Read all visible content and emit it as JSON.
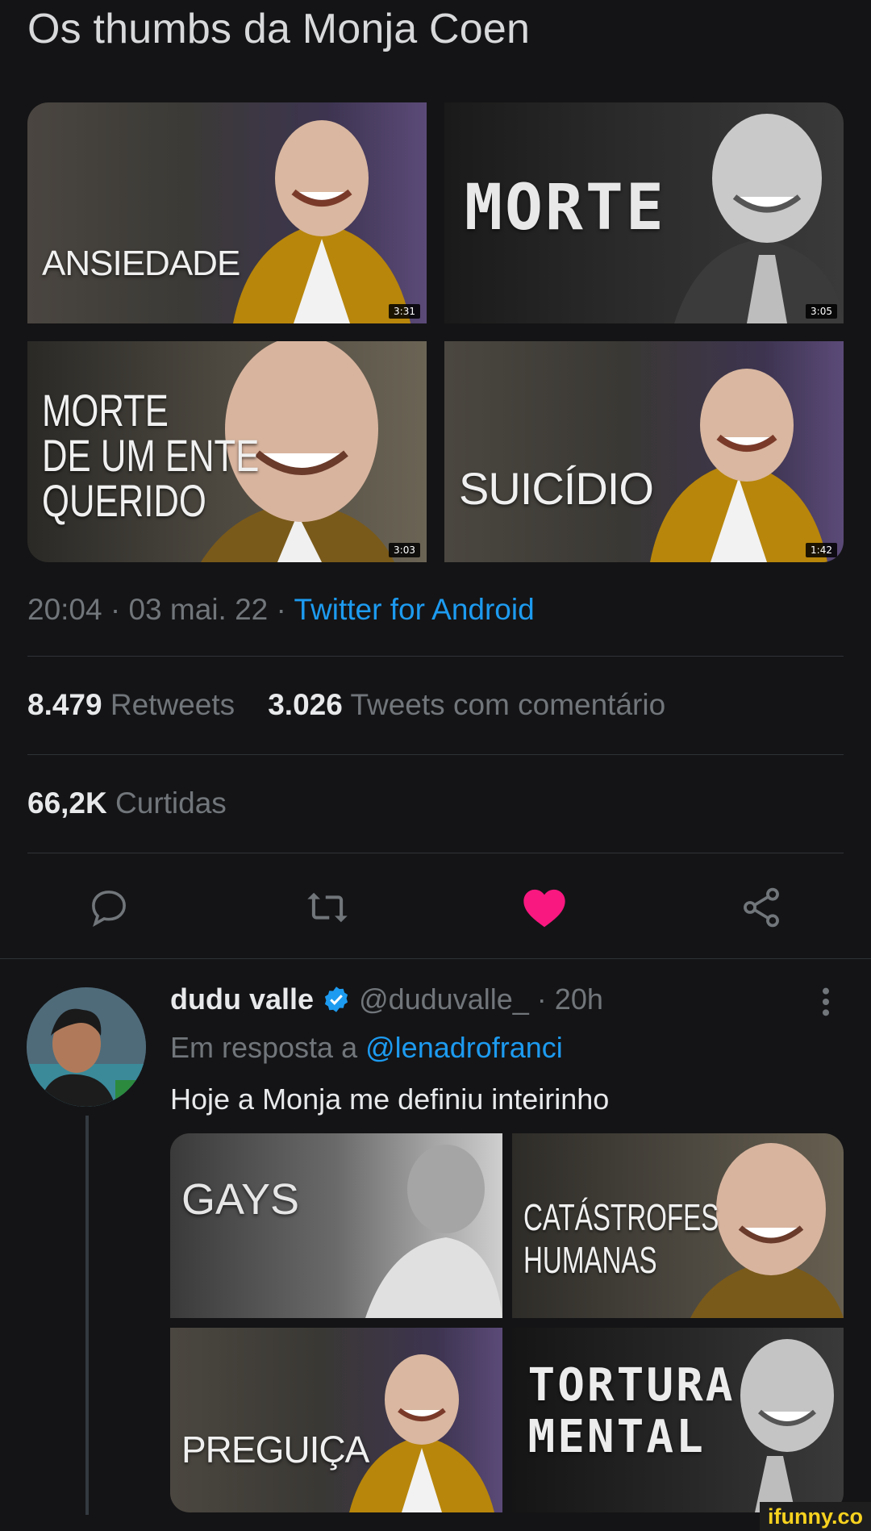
{
  "tweet": {
    "text": "Os thumbs da Monja Coen",
    "thumbnails": [
      {
        "label": "ANSIEDADE",
        "duration": "3:31"
      },
      {
        "label": "MORTE",
        "duration": "3:05"
      },
      {
        "label": "MORTE\nDE UM ENTE\nQUERIDO",
        "duration": "3:03"
      },
      {
        "label": "SUICÍDIO",
        "duration": "1:42"
      }
    ],
    "time": "20:04",
    "date": "03 mai. 22",
    "source": "Twitter for Android",
    "retweets_count": "8.479",
    "retweets_label": "Retweets",
    "quotes_count": "3.026",
    "quotes_label": "Tweets com comentário",
    "likes_count": "66,2K",
    "likes_label": "Curtidas"
  },
  "actions": [
    {
      "icon": "reply-icon"
    },
    {
      "icon": "retweet-icon"
    },
    {
      "icon": "heart-icon",
      "active": true,
      "color": "#f91880"
    },
    {
      "icon": "share-icon"
    }
  ],
  "reply": {
    "name": "dudu valle",
    "handle": "@duduvalle_",
    "time": "20h",
    "in_reply_prefix": "Em resposta a",
    "in_reply_handle": "@lenadrofranci",
    "text": "Hoje a Monja me definiu inteirinho",
    "thumbnails": [
      {
        "label": "GAYS"
      },
      {
        "label": "CATÁSTROFES\nHUMANAS"
      },
      {
        "label": "PREGUIÇA"
      },
      {
        "label": "TORTURA\nMENTAL"
      }
    ]
  },
  "colors": {
    "accent": "#1d9bf0",
    "like": "#f91880",
    "background": "#141416"
  },
  "watermark": "ifunny.co"
}
